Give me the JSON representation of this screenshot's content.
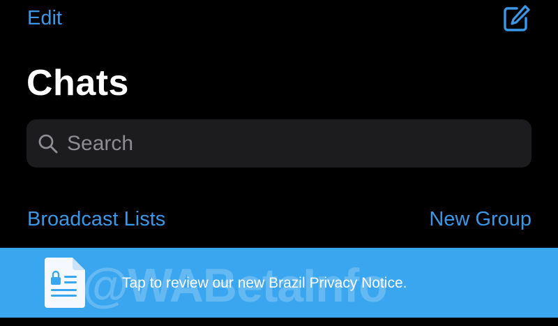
{
  "header": {
    "edit_label": "Edit",
    "compose_icon": "compose-icon",
    "title": "Chats"
  },
  "search": {
    "placeholder": "Search",
    "icon": "search-icon"
  },
  "actions": {
    "broadcast_label": "Broadcast Lists",
    "new_group_label": "New Group"
  },
  "banner": {
    "text": "Tap to review our new Brazil Privacy Notice.",
    "icon": "document-lock-icon",
    "watermark": "@WABetaInfo"
  },
  "colors": {
    "background": "#000000",
    "accent": "#3B97E8",
    "search_field": "#1C1C1E",
    "banner": "#3AA6EF"
  }
}
